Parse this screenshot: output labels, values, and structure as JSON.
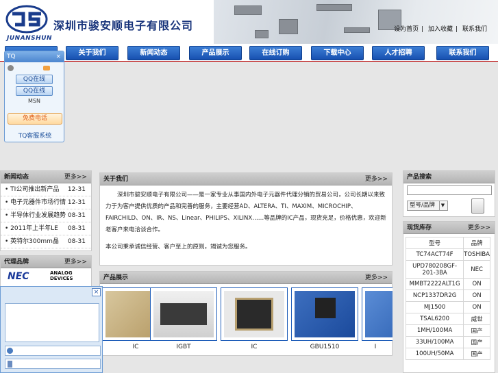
{
  "header": {
    "company_cn": "深圳市骏安顺电子有限公司",
    "company_en": "JUNANSHUN",
    "top_links": [
      "设为首页",
      "加入收藏",
      "联系我们"
    ]
  },
  "nav": [
    "关于我们",
    "新闻动态",
    "产品展示",
    "在线订购",
    "下载中心",
    "人才招聘",
    "联系我们"
  ],
  "tq": {
    "title": "TQ",
    "qq_buttons": [
      "QQ在线",
      "QQ在线"
    ],
    "msn": "MSN",
    "phone": "免费电话",
    "footer": "TQ客服系统"
  },
  "news": {
    "title": "新闻动态",
    "more": "更多>>",
    "items": [
      {
        "title": "TI公司推出新产品",
        "date": "12-31"
      },
      {
        "title": "电子元器件市场行情",
        "date": "12-31"
      },
      {
        "title": "半导体行业发展趋势",
        "date": "08-31"
      },
      {
        "title": "2011年上半年LE",
        "date": "08-31"
      },
      {
        "title": "英特尔300mm晶",
        "date": "08-31"
      }
    ]
  },
  "brands": {
    "title": "代理品牌",
    "more": "更多>>",
    "items": [
      "NEC",
      "ANALOG DEVICES"
    ]
  },
  "about": {
    "title": "关于我们",
    "more": "更多>>",
    "paragraphs": [
      "深圳市骏安顺电子有限公司——是一家专业从事国内外电子元器件代理分销的贸易公司，公司长期以来致力于为客户提供优质的产品和完善的服务，主要经营AD、ALTERA、TI、MAXIM、MICROCHIP、FAIRCHILD、ON、IR、NS、Linear、PHILIPS、XILINX……等品牌的IC产品，现货充足，价格优惠，欢迎新老客户来电洽谈合作。",
      "本公司秉承诚信经营、客户至上的原则，竭诚为您服务。"
    ]
  },
  "products": {
    "title": "产品展示",
    "more": "更多>>",
    "items": [
      {
        "name": "IC"
      },
      {
        "name": "IGBT"
      },
      {
        "name": "IC"
      },
      {
        "name": "GBU1510"
      },
      {
        "name": "I"
      }
    ]
  },
  "search": {
    "title": "产品搜索",
    "select_value": "型号/品牌",
    "button": ""
  },
  "stock": {
    "title": "现货库存",
    "more": "更多>>",
    "headers": [
      "型号",
      "品牌"
    ],
    "rows": [
      [
        "TC74ACT74F",
        "TOSHIBA"
      ],
      [
        "UPD780208GF-201-3BA",
        "NEC"
      ],
      [
        "MMBT2222ALT1G",
        "ON"
      ],
      [
        "NCP1337DR2G",
        "ON"
      ],
      [
        "MJ1500",
        "ON"
      ],
      [
        "TSAL6200",
        "威世"
      ],
      [
        "1MH/100MA",
        "国产"
      ],
      [
        "33UH/100MA",
        "国产"
      ],
      [
        "100UH/50MA",
        "国产"
      ]
    ]
  }
}
